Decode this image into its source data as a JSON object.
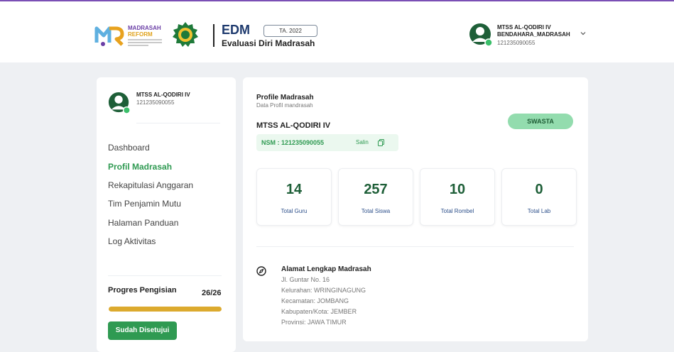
{
  "header": {
    "logo_text_1": "MADRASAH",
    "logo_text_2": "REFORM",
    "app_title": "EDM",
    "year_badge": "TA. 2022",
    "app_subtitle": "Evaluasi Diri Madrasah",
    "user_name": "MTSS AL-QODIRI IV",
    "user_role": "BENDAHARA_MADRASAH",
    "user_id": "121235090055"
  },
  "sidebar": {
    "school_name": "MTSS AL-QODIRI IV",
    "school_id": "121235090055",
    "nav": [
      {
        "label": "Dashboard",
        "active": false
      },
      {
        "label": "Profil Madrasah",
        "active": true
      },
      {
        "label": "Rekapitulasi Anggaran",
        "active": false
      },
      {
        "label": "Tim Penjamin Mutu",
        "active": false
      },
      {
        "label": "Halaman Panduan",
        "active": false
      },
      {
        "label": "Log Aktivitas",
        "active": false
      }
    ],
    "progress_label": "Progres Pengisian",
    "progress_count": "26/26",
    "progress_fraction": 1.0,
    "approved_label": "Sudah Disetujui"
  },
  "main": {
    "title": "Profile Madrasah",
    "subtitle": "Data Profil mandrasah",
    "status_badge": "SWASTA",
    "school_name": "MTSS AL-QODIRI IV",
    "nsm": "NSM : 121235090055",
    "copy_label": "Salin",
    "stats": [
      {
        "value": "14",
        "label": "Total Guru"
      },
      {
        "value": "257",
        "label": "Total Siswa"
      },
      {
        "value": "10",
        "label": "Total Rombel"
      },
      {
        "value": "0",
        "label": "Total Lab"
      }
    ],
    "address": {
      "title": "Alamat Lengkap Madrasah",
      "lines": [
        "Jl. Guntar No. 16",
        "Kelurahan: WRINGINAGUNG",
        "Kecamatan: JOMBANG",
        "Kabupaten/Kota: JEMBER",
        "Provinsi: JAWA TIMUR"
      ]
    }
  },
  "colors": {
    "accent_green": "#2f9a52",
    "dark_green": "#1e5f38",
    "progress_gold": "#dcaa2e",
    "badge_green": "#93dcae",
    "purple": "#7a4fb5"
  }
}
